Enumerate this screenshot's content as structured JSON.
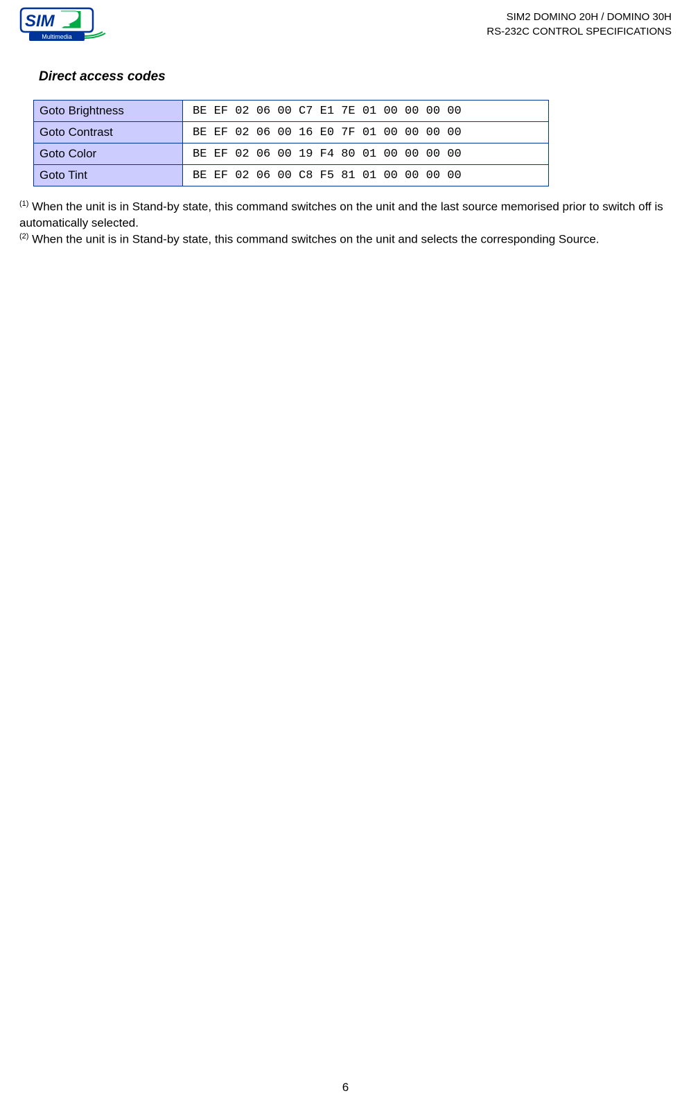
{
  "header": {
    "title_line1": "SIM2 DOMINO 20H / DOMINO 30H",
    "title_line2": "RS-232C CONTROL SPECIFICATIONS"
  },
  "section_title": "Direct access codes",
  "table": {
    "rows": [
      {
        "label": "Goto Brightness",
        "code": "BE EF 02 06 00 C7 E1 7E 01 00 00 00 00"
      },
      {
        "label": "Goto Contrast",
        "code": "BE EF 02 06 00 16 E0 7F 01 00 00 00 00"
      },
      {
        "label": "Goto Color",
        "code": "BE EF 02 06 00 19 F4 80 01 00 00 00 00"
      },
      {
        "label": "Goto Tint",
        "code": "BE EF 02 06 00 C8 F5 81 01 00 00 00 00"
      }
    ]
  },
  "footnotes": {
    "note1_sup": "(1)",
    "note1_text": "   When the unit is in Stand-by state, this command switches on the unit and the last source memorised prior to switch off is automatically selected.",
    "note2_sup": "(2)",
    "note2_text": "   When the unit is in Stand-by state, this command switches on the unit and selects the corresponding Source."
  },
  "page_number": "6"
}
